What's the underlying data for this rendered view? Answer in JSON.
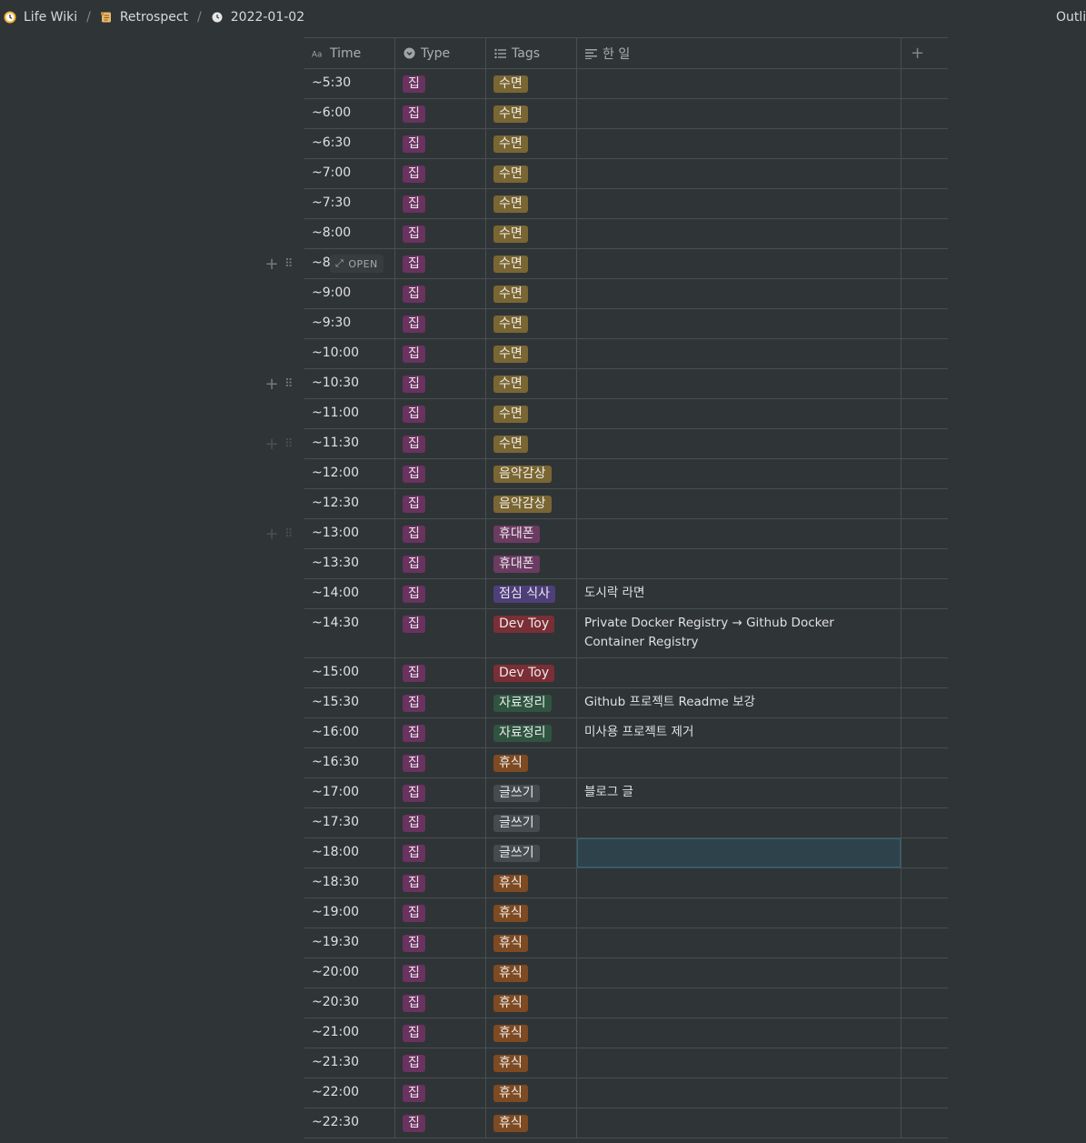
{
  "breadcrumb": [
    {
      "label": "Life Wiki",
      "icon": "clock-emoji-icon"
    },
    {
      "label": "Retrospect",
      "icon": "scroll-icon"
    },
    {
      "label": "2022-01-02",
      "icon": "clock-icon"
    }
  ],
  "breadcrumb_separator": "/",
  "outline_label": "Outline",
  "columns": {
    "time": {
      "label": "Time",
      "icon": "text-icon"
    },
    "type": {
      "label": "Type",
      "icon": "select-icon"
    },
    "tags": {
      "label": "Tags",
      "icon": "list-icon"
    },
    "work": {
      "label": "한 일",
      "icon": "paragraph-icon"
    },
    "add": {
      "label": "+",
      "icon": "plus-icon"
    }
  },
  "open_label": "OPEN",
  "tag_colors": {
    "수면": "#7a6632",
    "음악감상": "#7a6632",
    "휴대폰": "#6b3b62",
    "점심 식사": "#4e3f7a",
    "Dev Toy": "#7a2e35",
    "자료정리": "#2f5440",
    "휴식": "#7d4a22",
    "글쓰기": "#464b50"
  },
  "type_color": "#69325f",
  "rows": [
    {
      "time": "~5:30",
      "type": "집",
      "tag": "수면",
      "work": ""
    },
    {
      "time": "~6:00",
      "type": "집",
      "tag": "수면",
      "work": ""
    },
    {
      "time": "~6:30",
      "type": "집",
      "tag": "수면",
      "work": ""
    },
    {
      "time": "~7:00",
      "type": "집",
      "tag": "수면",
      "work": ""
    },
    {
      "time": "~7:30",
      "type": "집",
      "tag": "수면",
      "work": ""
    },
    {
      "time": "~8:00",
      "type": "집",
      "tag": "수면",
      "work": ""
    },
    {
      "time": "~8",
      "type": "집",
      "tag": "수면",
      "work": "",
      "hover": true,
      "open": true
    },
    {
      "time": "~9:00",
      "type": "집",
      "tag": "수면",
      "work": ""
    },
    {
      "time": "~9:30",
      "type": "집",
      "tag": "수면",
      "work": ""
    },
    {
      "time": "~10:00",
      "type": "집",
      "tag": "수면",
      "work": ""
    },
    {
      "time": "~10:30",
      "type": "집",
      "tag": "수면",
      "work": "",
      "hover": true
    },
    {
      "time": "~11:00",
      "type": "집",
      "tag": "수면",
      "work": ""
    },
    {
      "time": "~11:30",
      "type": "집",
      "tag": "수면",
      "work": "",
      "hover": true,
      "faint": true
    },
    {
      "time": "~12:00",
      "type": "집",
      "tag": "음악감상",
      "work": ""
    },
    {
      "time": "~12:30",
      "type": "집",
      "tag": "음악감상",
      "work": ""
    },
    {
      "time": "~13:00",
      "type": "집",
      "tag": "휴대폰",
      "work": "",
      "hover": true,
      "faint": true
    },
    {
      "time": "~13:30",
      "type": "집",
      "tag": "휴대폰",
      "work": ""
    },
    {
      "time": "~14:00",
      "type": "집",
      "tag": "점심 식사",
      "work": "도시락 라면"
    },
    {
      "time": "~14:30",
      "type": "집",
      "tag": "Dev Toy",
      "work": "Private Docker Registry → Github Docker Container Registry",
      "tall": true
    },
    {
      "time": "~15:00",
      "type": "집",
      "tag": "Dev Toy",
      "work": ""
    },
    {
      "time": "~15:30",
      "type": "집",
      "tag": "자료정리",
      "work": "Github 프로젝트 Readme 보강"
    },
    {
      "time": "~16:00",
      "type": "집",
      "tag": "자료정리",
      "work": "미사용 프로젝트 제거"
    },
    {
      "time": "~16:30",
      "type": "집",
      "tag": "휴식",
      "work": ""
    },
    {
      "time": "~17:00",
      "type": "집",
      "tag": "글쓰기",
      "work": "블로그 글"
    },
    {
      "time": "~17:30",
      "type": "집",
      "tag": "글쓰기",
      "work": ""
    },
    {
      "time": "~18:00",
      "type": "집",
      "tag": "글쓰기",
      "work": "",
      "selected": true
    },
    {
      "time": "~18:30",
      "type": "집",
      "tag": "휴식",
      "work": ""
    },
    {
      "time": "~19:00",
      "type": "집",
      "tag": "휴식",
      "work": ""
    },
    {
      "time": "~19:30",
      "type": "집",
      "tag": "휴식",
      "work": ""
    },
    {
      "time": "~20:00",
      "type": "집",
      "tag": "휴식",
      "work": ""
    },
    {
      "time": "~20:30",
      "type": "집",
      "tag": "휴식",
      "work": ""
    },
    {
      "time": "~21:00",
      "type": "집",
      "tag": "휴식",
      "work": ""
    },
    {
      "time": "~21:30",
      "type": "집",
      "tag": "휴식",
      "work": ""
    },
    {
      "time": "~22:00",
      "type": "집",
      "tag": "휴식",
      "work": ""
    },
    {
      "time": "~22:30",
      "type": "집",
      "tag": "휴식",
      "work": ""
    }
  ]
}
